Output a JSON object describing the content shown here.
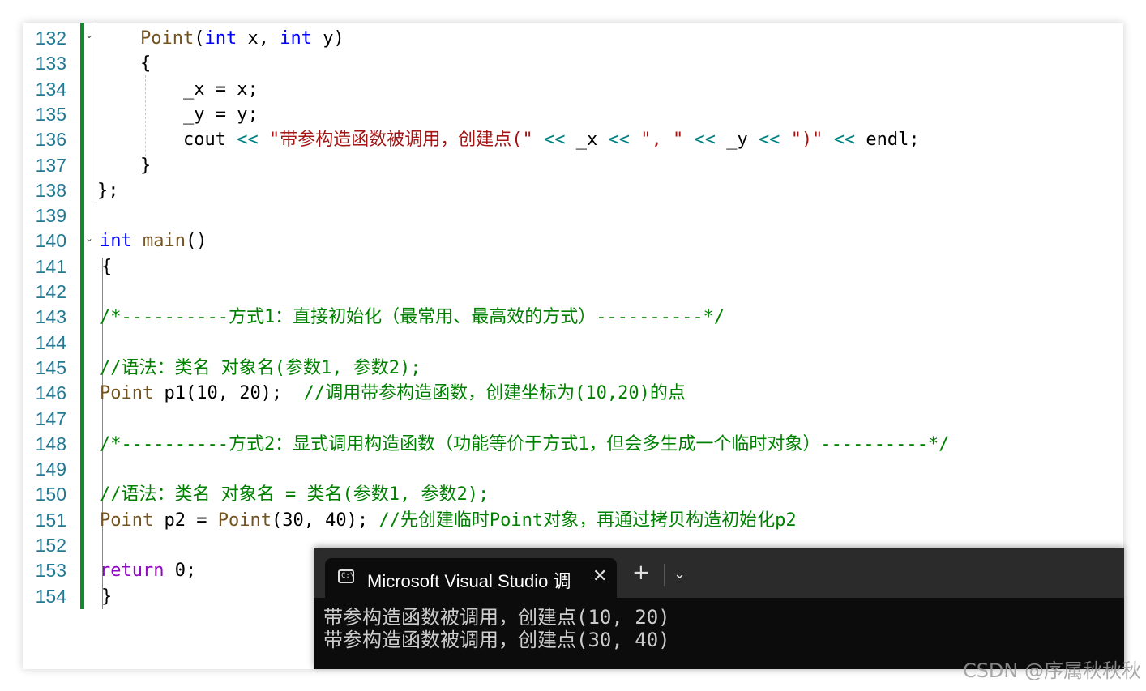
{
  "editor": {
    "lines": [
      {
        "n": "132",
        "parts": [
          [
            "fn",
            "Point"
          ],
          [
            "",
            "("
          ],
          [
            "kw",
            "int"
          ],
          [
            "",
            " x, "
          ],
          [
            "kw",
            "int"
          ],
          [
            "",
            " y)"
          ]
        ],
        "indent": 2
      },
      {
        "n": "133",
        "parts": [
          [
            "",
            "{"
          ]
        ],
        "indent": 2
      },
      {
        "n": "134",
        "parts": [
          [
            "",
            "_x = x;"
          ]
        ],
        "indent": 3
      },
      {
        "n": "135",
        "parts": [
          [
            "",
            "_y = y;"
          ]
        ],
        "indent": 3
      },
      {
        "n": "136",
        "parts": [
          [
            "",
            "cout "
          ],
          [
            "op",
            "<<"
          ],
          [
            "",
            " "
          ],
          [
            "str",
            "\"带参构造函数被调用，创建点(\""
          ],
          [
            "",
            " "
          ],
          [
            "op",
            "<<"
          ],
          [
            "",
            " _x "
          ],
          [
            "op",
            "<<"
          ],
          [
            "",
            " "
          ],
          [
            "str",
            "\", \""
          ],
          [
            "",
            " "
          ],
          [
            "op",
            "<<"
          ],
          [
            "",
            " _y "
          ],
          [
            "op",
            "<<"
          ],
          [
            "",
            " "
          ],
          [
            "str",
            "\")\""
          ],
          [
            "",
            " "
          ],
          [
            "op",
            "<<"
          ],
          [
            "",
            " endl;"
          ]
        ],
        "indent": 3
      },
      {
        "n": "137",
        "parts": [
          [
            "",
            "}"
          ]
        ],
        "indent": 2
      },
      {
        "n": "138",
        "parts": [
          [
            "",
            "};"
          ]
        ],
        "indent": 0
      },
      {
        "n": "139",
        "parts": [],
        "indent": 0
      },
      {
        "n": "140",
        "parts": [
          [
            "kw",
            "int"
          ],
          [
            "",
            " "
          ],
          [
            "fn",
            "main"
          ],
          [
            "",
            "()"
          ]
        ],
        "indent": 0
      },
      {
        "n": "141",
        "parts": [
          [
            "",
            "{"
          ]
        ],
        "indent": 0
      },
      {
        "n": "142",
        "parts": [],
        "indent": 0
      },
      {
        "n": "143",
        "parts": [
          [
            "cm",
            "/*----------方式1：直接初始化（最常用、最高效的方式）----------*/"
          ]
        ],
        "indent": 1
      },
      {
        "n": "144",
        "parts": [],
        "indent": 0
      },
      {
        "n": "145",
        "parts": [
          [
            "cm",
            "//语法：类名 对象名(参数1, 参数2);"
          ]
        ],
        "indent": 1
      },
      {
        "n": "146",
        "parts": [
          [
            "fn",
            "Point"
          ],
          [
            "",
            " p1(10, 20);  "
          ],
          [
            "cm",
            "//调用带参构造函数，创建坐标为(10,20)的点"
          ]
        ],
        "indent": 1
      },
      {
        "n": "147",
        "parts": [],
        "indent": 0
      },
      {
        "n": "148",
        "parts": [
          [
            "cm",
            "/*----------方式2：显式调用构造函数（功能等价于方式1，但会多生成一个临时对象）----------*/"
          ]
        ],
        "indent": 1
      },
      {
        "n": "149",
        "parts": [],
        "indent": 0
      },
      {
        "n": "150",
        "parts": [
          [
            "cm",
            "//语法：类名 对象名 = 类名(参数1, 参数2);"
          ]
        ],
        "indent": 1
      },
      {
        "n": "151",
        "parts": [
          [
            "fn",
            "Point"
          ],
          [
            "",
            " p2 = "
          ],
          [
            "fn",
            "Point"
          ],
          [
            "",
            "(30, 40); "
          ],
          [
            "cm",
            "//先创建临时Point对象，再通过拷贝构造初始化p2"
          ]
        ],
        "indent": 1
      },
      {
        "n": "152",
        "parts": [],
        "indent": 0
      },
      {
        "n": "153",
        "parts": [
          [
            "ret",
            "return"
          ],
          [
            "",
            " 0;"
          ]
        ],
        "indent": 1
      },
      {
        "n": "154",
        "parts": [
          [
            "",
            "}"
          ]
        ],
        "indent": 0
      }
    ]
  },
  "console": {
    "tab_title": "Microsoft Visual Studio 调",
    "tab_icon": "terminal-icon",
    "close_glyph": "✕",
    "new_tab_glyph": "+",
    "dropdown_glyph": "⌄",
    "output": [
      "带参构造函数被调用，创建点(10, 20)",
      "带参构造函数被调用，创建点(30, 40)"
    ]
  },
  "watermark": "CSDN @序属秋秋秋",
  "colors": {
    "keyword": "#0000ff",
    "string": "#a31515",
    "comment": "#008000",
    "return_keyword": "#8f08c4",
    "function": "#74531f",
    "change_bar": "#108a2c"
  }
}
